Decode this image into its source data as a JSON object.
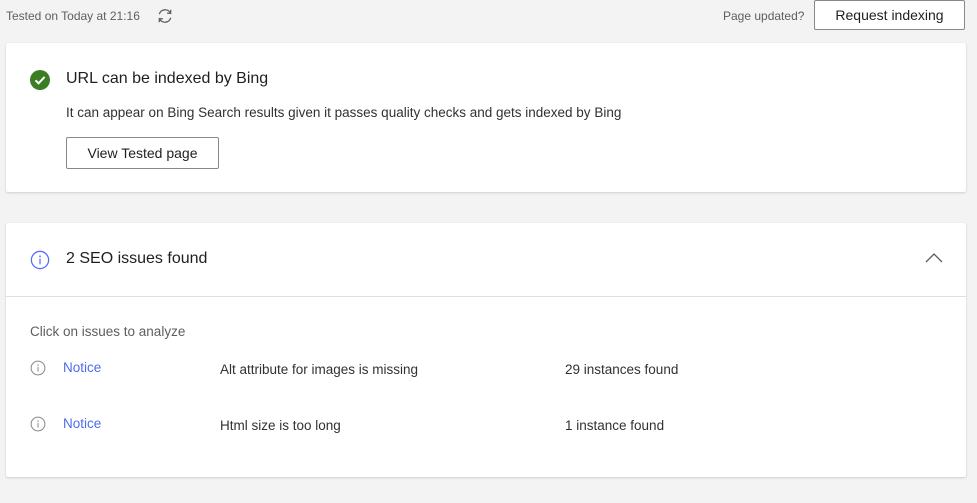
{
  "topbar": {
    "tested_text": "Tested on Today at 21:16",
    "refresh_icon": "refresh-icon",
    "page_updated_text": "Page updated?",
    "request_indexing_label": "Request indexing"
  },
  "status_card": {
    "icon": "check-circle-icon",
    "icon_color": "#3a7d22",
    "title": "URL can be indexed by Bing",
    "description": "It can appear on Bing Search results given it passes quality checks and gets indexed by Bing",
    "view_button_label": "View Tested page"
  },
  "issues_card": {
    "icon": "info-icon",
    "title": "2 SEO issues found",
    "collapse_icon": "chevron-up-icon",
    "hint": "Click on issues to analyze",
    "issues": [
      {
        "severity": "Notice",
        "name": "Alt attribute for images is missing",
        "count": "29 instances found"
      },
      {
        "severity": "Notice",
        "name": "Html size is too long",
        "count": "1 instance found"
      }
    ]
  },
  "colors": {
    "background": "#f3f3f3",
    "card": "#ffffff",
    "link_accent": "#4f6bed",
    "success": "#3a7d22"
  }
}
